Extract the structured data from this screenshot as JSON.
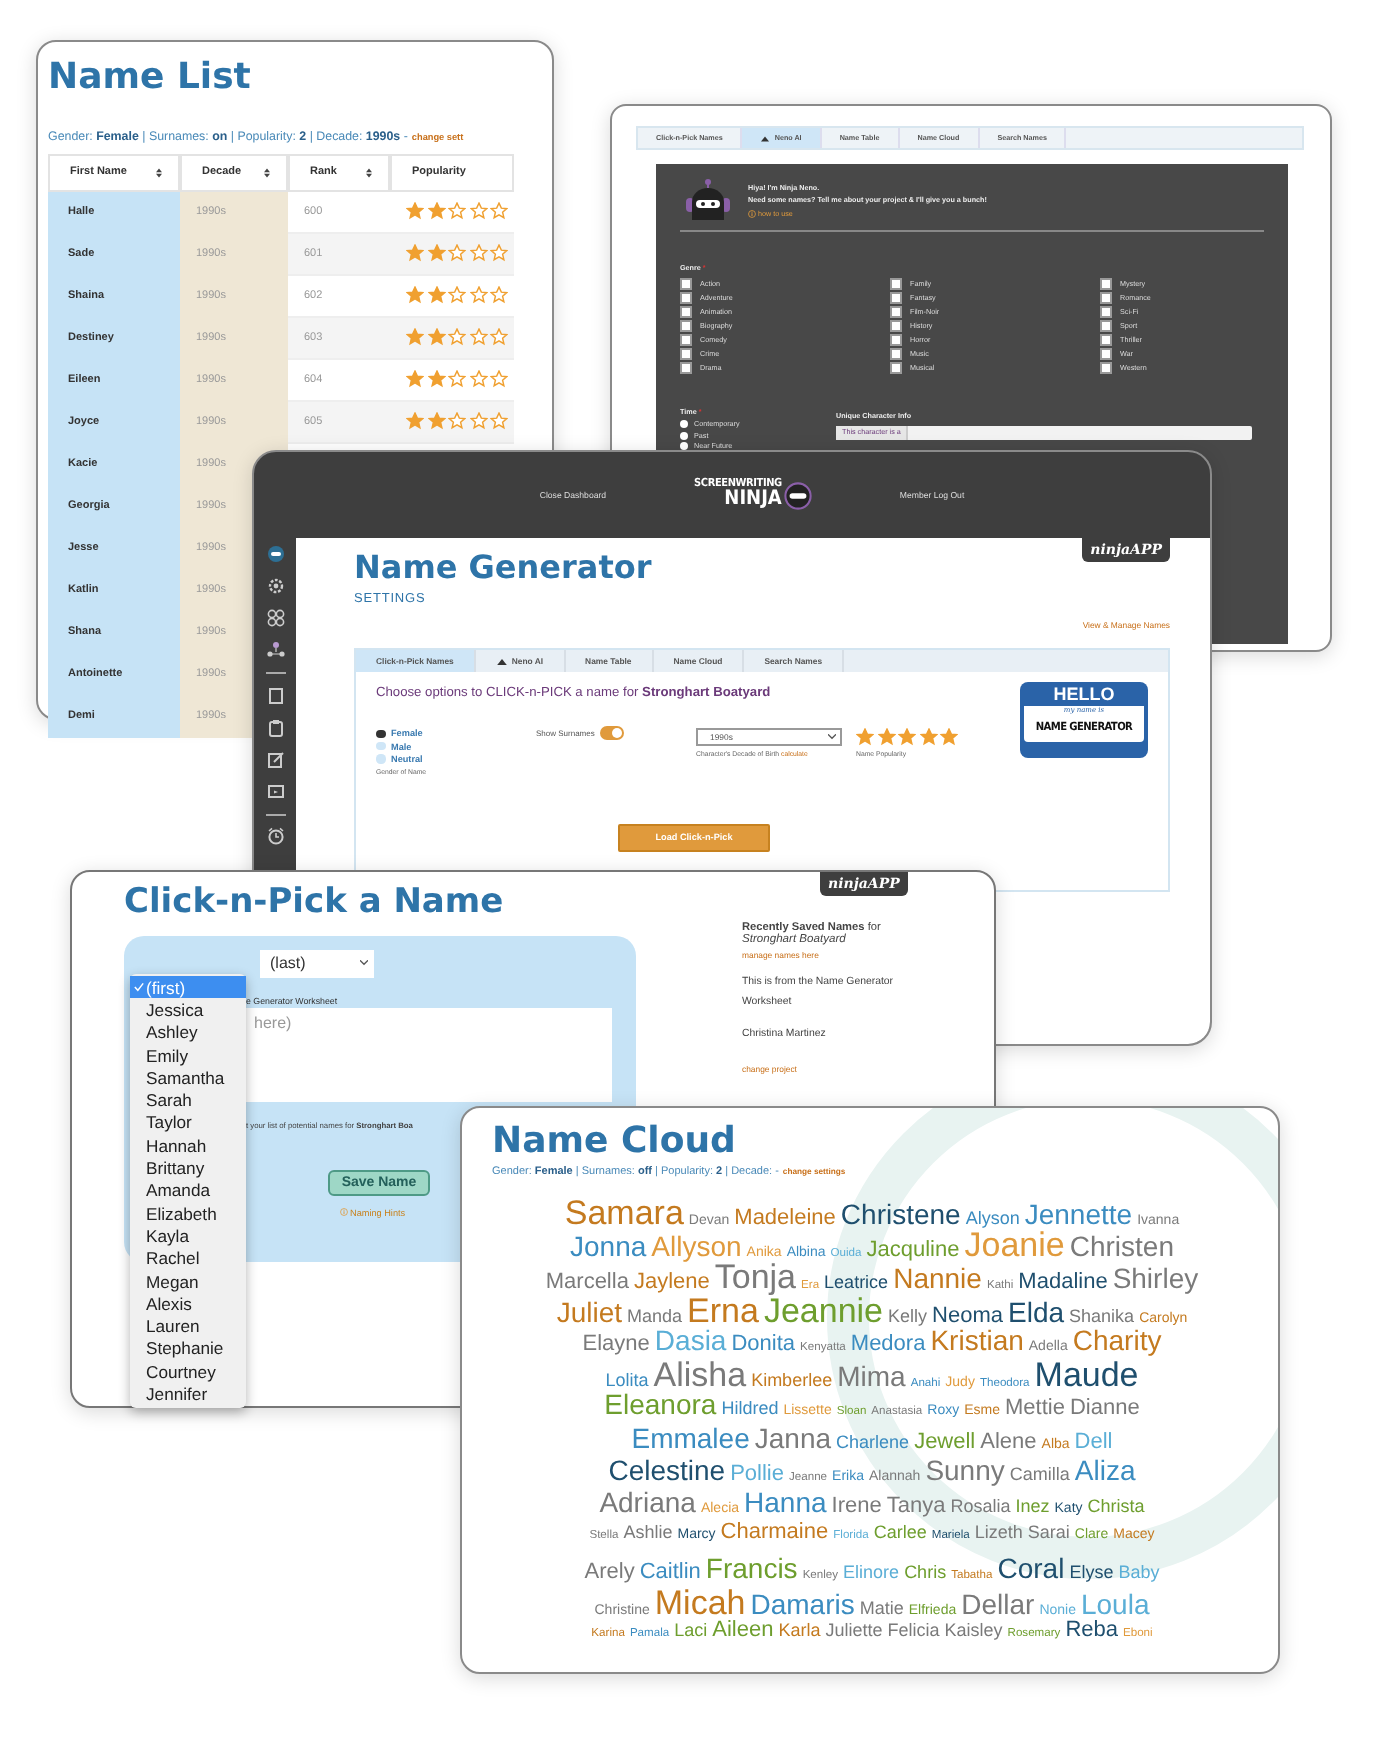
{
  "name_list": {
    "title": "Name List",
    "filter": "Gender: **Female** | Surnames: **on** | Popularity: **2** | Decade: **1990s** -",
    "change_link": "change sett",
    "columns": [
      "First Name",
      "Decade",
      "Rank",
      "Popularity"
    ],
    "rows": [
      {
        "name": "Halle",
        "decade": "1990s",
        "rank": "600",
        "stars": 2
      },
      {
        "name": "Sade",
        "decade": "1990s",
        "rank": "601",
        "stars": 2
      },
      {
        "name": "Shaina",
        "decade": "1990s",
        "rank": "602",
        "stars": 2
      },
      {
        "name": "Destiney",
        "decade": "1990s",
        "rank": "603",
        "stars": 2
      },
      {
        "name": "Eileen",
        "decade": "1990s",
        "rank": "604",
        "stars": 2
      },
      {
        "name": "Joyce",
        "decade": "1990s",
        "rank": "605",
        "stars": 2
      },
      {
        "name": "Kacie",
        "decade": "1990s"
      },
      {
        "name": "Georgia",
        "decade": "1990s"
      },
      {
        "name": "Jesse",
        "decade": "1990s"
      },
      {
        "name": "Katlin",
        "decade": "1990s"
      },
      {
        "name": "Shana",
        "decade": "1990s"
      },
      {
        "name": "Antoinette",
        "decade": "1990s"
      },
      {
        "name": "Demi",
        "decade": "1990s"
      }
    ]
  },
  "neno": {
    "tabs": [
      {
        "label": "Click-n-Pick Names",
        "selected": false,
        "kind": "text"
      },
      {
        "label": "Neno AI",
        "selected": true,
        "kind": "icon"
      },
      {
        "label": "Name Table",
        "selected": false,
        "kind": "text"
      },
      {
        "label": "Name Cloud",
        "selected": false,
        "kind": "text"
      },
      {
        "label": "Search Names",
        "selected": false,
        "kind": "text"
      }
    ],
    "greeting": "Hiya! I'm Ninja Neno.",
    "intro": "Need some names? Tell me about your project & I'll give you a bunch!",
    "help_link": "how to use",
    "genre_label": "Genre",
    "required_mark": "*",
    "genres": [
      {
        "label": "Action",
        "checked": false
      },
      {
        "label": "Adventure",
        "checked": false
      },
      {
        "label": "Animation",
        "checked": false
      },
      {
        "label": "Biography",
        "checked": false
      },
      {
        "label": "Comedy",
        "checked": false
      },
      {
        "label": "Crime",
        "checked": false
      },
      {
        "label": "Drama",
        "checked": false
      },
      {
        "label": "Family",
        "checked": false
      },
      {
        "label": "Fantasy",
        "checked": false
      },
      {
        "label": "Film-Noir",
        "checked": false
      },
      {
        "label": "History",
        "checked": false
      },
      {
        "label": "Horror",
        "checked": false
      },
      {
        "label": "Music",
        "checked": false
      },
      {
        "label": "Musical",
        "checked": false
      },
      {
        "label": "Mystery",
        "checked": false
      },
      {
        "label": "Romance",
        "checked": false
      },
      {
        "label": "Sci-Fi",
        "checked": false
      },
      {
        "label": "Sport",
        "checked": false
      },
      {
        "label": "Thriller",
        "checked": false
      },
      {
        "label": "War",
        "checked": false
      },
      {
        "label": "Western",
        "checked": false
      }
    ],
    "time_label": "Time",
    "time_required_mark": "*",
    "times": [
      {
        "label": "Contemporary",
        "selected": false
      },
      {
        "label": "Past",
        "selected": false
      },
      {
        "label": "Near Future",
        "selected": false
      }
    ],
    "info_label": "Unique Character Info",
    "info_value": "This character is a"
  },
  "generator": {
    "nav": [
      "Close Dashboard",
      "Member Log Out"
    ],
    "logo_top": "SCREENWRITING",
    "logo_bottom": "NINJA",
    "badge": "ninjaAPP",
    "title": "Name Generator",
    "subtitle": "SETTINGS",
    "manage_link": "View & Manage Names",
    "tabs": [
      {
        "label": "Click-n-Pick Names",
        "selected": true,
        "kind": "text"
      },
      {
        "label": "Neno AI",
        "selected": false,
        "kind": "icon"
      },
      {
        "label": "Name Table",
        "selected": false,
        "kind": "text"
      },
      {
        "label": "Name Cloud",
        "selected": false,
        "kind": "text"
      },
      {
        "label": "Search Names",
        "selected": false,
        "kind": "text"
      }
    ],
    "prompt": "Choose options to CLICK-n-PICK a name for **Stronghart Boatyard**",
    "genders": [
      {
        "label": "Female",
        "selected": true
      },
      {
        "label": "Male",
        "selected": false
      },
      {
        "label": "Neutral",
        "selected": false
      }
    ],
    "gender_caption": "Gender of Name",
    "surnames": {
      "label": "Show Surnames",
      "on": true
    },
    "decade": {
      "value": "1990s",
      "caption": "Character's Decade of Birth",
      "link": "calculate"
    },
    "popularity": {
      "stars": 5,
      "caption": "Name Popularity"
    },
    "name_tag": {
      "title": "HELLO",
      "line": "my name is",
      "name": "NAME GENERATOR"
    },
    "button": "Load Click-n-Pick"
  },
  "click_pick": {
    "title": "Click-n-Pick a Name",
    "badge": "ninjaAPP",
    "first_menu": [
      {
        "label": "(first)",
        "selected": true
      },
      {
        "label": "Jessica",
        "selected": false
      },
      {
        "label": "Ashley",
        "selected": false
      },
      {
        "label": "Emily",
        "selected": false
      },
      {
        "label": "Samantha",
        "selected": false
      },
      {
        "label": "Sarah",
        "selected": false
      },
      {
        "label": "Taylor",
        "selected": false
      },
      {
        "label": "Hannah",
        "selected": false
      },
      {
        "label": "Brittany",
        "selected": false
      },
      {
        "label": "Amanda",
        "selected": false
      },
      {
        "label": "Elizabeth",
        "selected": false
      },
      {
        "label": "Kayla",
        "selected": false
      },
      {
        "label": "Rachel",
        "selected": false
      },
      {
        "label": "Megan",
        "selected": false
      },
      {
        "label": "Alexis",
        "selected": false
      },
      {
        "label": "Lauren",
        "selected": false
      },
      {
        "label": "Stephanie",
        "selected": false
      },
      {
        "label": "Courtney",
        "selected": false
      },
      {
        "label": "Jennifer",
        "selected": false
      }
    ],
    "last_select": "(last)",
    "worksheet_label": "e Generator Worksheet",
    "notes_placeholder": "here)",
    "hint": "t your list of potential names for **Stronghart Boa**",
    "save_button": "Save Name",
    "hints_link": "Naming Hints",
    "recent": {
      "heading": "**Recently Saved Names** for",
      "project": "Stronghart Boatyard",
      "manage": "manage names here",
      "items": [
        "This is from the Name Generator Worksheet",
        "Christina Martinez"
      ],
      "change": "change project"
    }
  },
  "name_cloud": {
    "title": "Name Cloud",
    "filter": "Gender: **Female** | Surnames: **off** | Popularity: **2** | Decade: -",
    "change_link": "change settings",
    "lines": [
      {
        "words": [
          {
            "text": "Samara",
            "kind": "xl",
            "color": "#c47a1f"
          },
          {
            "text": "Devan",
            "kind": "xs",
            "color": "#7a7a7a"
          },
          {
            "text": "Madeleine",
            "kind": "m",
            "color": "#c47a1f"
          },
          {
            "text": "Christene",
            "kind": "l",
            "color": "#1f4f6e"
          },
          {
            "text": "Alyson",
            "kind": "s",
            "color": "#3b8cc0"
          },
          {
            "text": "Jennette",
            "kind": "l",
            "color": "#3b8cc0"
          },
          {
            "text": "Ivanna",
            "kind": "xs",
            "color": "#7a7a7a"
          }
        ]
      },
      {
        "words": [
          {
            "text": "Jonna",
            "kind": "l",
            "color": "#3b8cc0"
          },
          {
            "text": "Allyson",
            "kind": "l",
            "color": "#e09a3c"
          },
          {
            "text": "Anika",
            "kind": "xs",
            "color": "#e09a3c"
          },
          {
            "text": "Albina",
            "kind": "xs",
            "color": "#3b8cc0"
          },
          {
            "text": "Ouida",
            "kind": "xxs",
            "color": "#5aaed6"
          },
          {
            "text": "Jacquline",
            "kind": "m",
            "color": "#6e9e2e"
          },
          {
            "text": "Joanie",
            "kind": "xl",
            "color": "#e09a3c"
          },
          {
            "text": "Christen",
            "kind": "l",
            "color": "#7a7a7a"
          }
        ]
      },
      {
        "words": [
          {
            "text": "Marcella",
            "kind": "m",
            "color": "#7a7a7a"
          },
          {
            "text": "Jaylene",
            "kind": "m",
            "color": "#c47a1f"
          },
          {
            "text": "Tonja",
            "kind": "xl",
            "color": "#7a7a7a"
          },
          {
            "text": "Era",
            "kind": "xxs",
            "color": "#e09a3c"
          },
          {
            "text": "Leatrice",
            "kind": "s",
            "color": "#1f4f6e"
          },
          {
            "text": "Nannie",
            "kind": "l",
            "color": "#c47a1f"
          },
          {
            "text": "Kathi",
            "kind": "xxs",
            "color": "#7a7a7a"
          },
          {
            "text": "Madaline",
            "kind": "m",
            "color": "#1f4f6e"
          },
          {
            "text": "Shirley",
            "kind": "l",
            "color": "#7a7a7a"
          }
        ]
      },
      {
        "words": [
          {
            "text": "Juliet",
            "kind": "l",
            "color": "#c47a1f"
          },
          {
            "text": "Manda",
            "kind": "s",
            "color": "#7a7a7a"
          },
          {
            "text": "Erna",
            "kind": "xl",
            "color": "#c47a1f"
          },
          {
            "text": "Jeannie",
            "kind": "xl",
            "color": "#6e9e2e"
          },
          {
            "text": "Kelly",
            "kind": "s",
            "color": "#7a7a7a"
          },
          {
            "text": "Neoma",
            "kind": "m",
            "color": "#1f4f6e"
          },
          {
            "text": "Elda",
            "kind": "l",
            "color": "#1f4f6e"
          },
          {
            "text": "Shanika",
            "kind": "s",
            "color": "#7a7a7a"
          },
          {
            "text": "Carolyn",
            "kind": "xs",
            "color": "#c47a1f"
          }
        ]
      },
      {
        "words": [
          {
            "text": "Elayne",
            "kind": "m",
            "color": "#7a7a7a"
          },
          {
            "text": "Dasia",
            "kind": "l",
            "color": "#5aaed6"
          },
          {
            "text": "Donita",
            "kind": "m",
            "color": "#3b8cc0"
          },
          {
            "text": "Kenyatta",
            "kind": "xxs",
            "color": "#7a7a7a"
          },
          {
            "text": "Medora",
            "kind": "m",
            "color": "#3b8cc0"
          },
          {
            "text": "Kristian",
            "kind": "l",
            "color": "#c47a1f"
          },
          {
            "text": "Adella",
            "kind": "xs",
            "color": "#7a7a7a"
          },
          {
            "text": "Charity",
            "kind": "l",
            "color": "#c47a1f"
          }
        ]
      },
      {
        "words": [
          {
            "text": "Lolita",
            "kind": "s",
            "color": "#3b8cc0"
          },
          {
            "text": "Alisha",
            "kind": "xl",
            "color": "#7a7a7a"
          },
          {
            "text": "Kimberlee",
            "kind": "s",
            "color": "#c47a1f"
          },
          {
            "text": "Mima",
            "kind": "l",
            "color": "#7a7a7a"
          },
          {
            "text": "Anahi",
            "kind": "xxs",
            "color": "#3b8cc0"
          },
          {
            "text": "Judy",
            "kind": "xs",
            "color": "#e09a3c"
          },
          {
            "text": "Theodora",
            "kind": "xxs",
            "color": "#3b8cc0"
          },
          {
            "text": "Maude",
            "kind": "xl",
            "color": "#1f4f6e"
          }
        ]
      },
      {
        "words": [
          {
            "text": "Eleanora",
            "kind": "l",
            "color": "#6e9e2e"
          },
          {
            "text": "Hildred",
            "kind": "s",
            "color": "#3b8cc0"
          },
          {
            "text": "Lissette",
            "kind": "xs",
            "color": "#e09a3c"
          },
          {
            "text": "Sloan",
            "kind": "xxs",
            "color": "#6e9e2e"
          },
          {
            "text": "Anastasia",
            "kind": "xxs",
            "color": "#7a7a7a"
          },
          {
            "text": "Roxy",
            "kind": "xs",
            "color": "#3b8cc0"
          },
          {
            "text": "Esme",
            "kind": "xs",
            "color": "#c47a1f"
          },
          {
            "text": "Mettie",
            "kind": "m",
            "color": "#7a7a7a"
          },
          {
            "text": "Dianne",
            "kind": "m",
            "color": "#7a7a7a"
          }
        ]
      },
      {
        "words": [
          {
            "text": "Emmalee",
            "kind": "l",
            "color": "#3b8cc0"
          },
          {
            "text": "Janna",
            "kind": "l",
            "color": "#7a7a7a"
          },
          {
            "text": "Charlene",
            "kind": "s",
            "color": "#3b8cc0"
          },
          {
            "text": "Jewell",
            "kind": "m",
            "color": "#6e9e2e"
          },
          {
            "text": "Alene",
            "kind": "m",
            "color": "#7a7a7a"
          },
          {
            "text": "Alba",
            "kind": "xs",
            "color": "#c47a1f"
          },
          {
            "text": "Dell",
            "kind": "m",
            "color": "#5aaed6"
          }
        ]
      },
      {
        "words": [
          {
            "text": "Celestine",
            "kind": "l",
            "color": "#1f4f6e"
          },
          {
            "text": "Pollie",
            "kind": "m",
            "color": "#5aaed6"
          },
          {
            "text": "Jeanne",
            "kind": "xxs",
            "color": "#7a7a7a"
          },
          {
            "text": "Erika",
            "kind": "xs",
            "color": "#3b8cc0"
          },
          {
            "text": "Alannah",
            "kind": "xs",
            "color": "#7a7a7a"
          },
          {
            "text": "Sunny",
            "kind": "l",
            "color": "#7a7a7a"
          },
          {
            "text": "Camilla",
            "kind": "s",
            "color": "#7a7a7a"
          },
          {
            "text": "Aliza",
            "kind": "l",
            "color": "#3b8cc0"
          }
        ]
      },
      {
        "words": [
          {
            "text": "Adriana",
            "kind": "l",
            "color": "#7a7a7a"
          },
          {
            "text": "Alecia",
            "kind": "xs",
            "color": "#e09a3c"
          },
          {
            "text": "Hanna",
            "kind": "l",
            "color": "#3b8cc0"
          },
          {
            "text": "Irene",
            "kind": "m",
            "color": "#7a7a7a"
          },
          {
            "text": "Tanya",
            "kind": "m",
            "color": "#7a7a7a"
          },
          {
            "text": "Rosalia",
            "kind": "s",
            "color": "#7a7a7a"
          },
          {
            "text": "Inez",
            "kind": "s",
            "color": "#6e9e2e"
          },
          {
            "text": "Katy",
            "kind": "xs",
            "color": "#1f4f6e"
          },
          {
            "text": "Christa",
            "kind": "s",
            "color": "#6e9e2e"
          }
        ]
      },
      {
        "words": [
          {
            "text": "Stella",
            "kind": "xxs",
            "color": "#7a7a7a"
          },
          {
            "text": "Ashlie",
            "kind": "s",
            "color": "#7a7a7a"
          },
          {
            "text": "Marcy",
            "kind": "xs",
            "color": "#1f4f6e"
          },
          {
            "text": "Charmaine",
            "kind": "m",
            "color": "#c47a1f"
          },
          {
            "text": "Florida",
            "kind": "xxs",
            "color": "#5aaed6"
          },
          {
            "text": "Carlee",
            "kind": "s",
            "color": "#6e9e2e"
          },
          {
            "text": "Mariela",
            "kind": "xxs",
            "color": "#1f4f6e"
          },
          {
            "text": "Lizeth",
            "kind": "s",
            "color": "#7a7a7a"
          },
          {
            "text": "Sarai",
            "kind": "s",
            "color": "#7a7a7a"
          },
          {
            "text": "Clare",
            "kind": "xs",
            "color": "#6e9e2e"
          },
          {
            "text": "Macey",
            "kind": "xs",
            "color": "#c47a1f"
          }
        ]
      },
      {
        "words": [
          {
            "text": "Arely",
            "kind": "m",
            "color": "#7a7a7a"
          },
          {
            "text": "Caitlin",
            "kind": "m",
            "color": "#3b8cc0"
          },
          {
            "text": "Francis",
            "kind": "l",
            "color": "#6e9e2e"
          },
          {
            "text": "Kenley",
            "kind": "xxs",
            "color": "#7a7a7a"
          },
          {
            "text": "Elinore",
            "kind": "s",
            "color": "#5aaed6"
          },
          {
            "text": "Chris",
            "kind": "s",
            "color": "#6e9e2e"
          },
          {
            "text": "Tabatha",
            "kind": "xxs",
            "color": "#c47a1f"
          },
          {
            "text": "Coral",
            "kind": "l",
            "color": "#1f4f6e"
          },
          {
            "text": "Elyse",
            "kind": "s",
            "color": "#1f4f6e"
          },
          {
            "text": "Baby",
            "kind": "s",
            "color": "#5aaed6"
          }
        ]
      },
      {
        "words": [
          {
            "text": "Christine",
            "kind": "xs",
            "color": "#7a7a7a"
          },
          {
            "text": "Micah",
            "kind": "xl",
            "color": "#c47a1f"
          },
          {
            "text": "Damaris",
            "kind": "l",
            "color": "#3b8cc0"
          },
          {
            "text": "Matie",
            "kind": "s",
            "color": "#7a7a7a"
          },
          {
            "text": "Elfrieda",
            "kind": "xs",
            "color": "#6e9e2e"
          },
          {
            "text": "Dellar",
            "kind": "l",
            "color": "#7a7a7a"
          },
          {
            "text": "Nonie",
            "kind": "xs",
            "color": "#5aaed6"
          },
          {
            "text": "Loula",
            "kind": "l",
            "color": "#5aaed6"
          }
        ]
      },
      {
        "words": [
          {
            "text": "Karina",
            "kind": "xxs",
            "color": "#c47a1f"
          },
          {
            "text": "Pamala",
            "kind": "xxs",
            "color": "#3b8cc0"
          },
          {
            "text": "Laci",
            "kind": "s",
            "color": "#6e9e2e"
          },
          {
            "text": "Aileen",
            "kind": "m",
            "color": "#6e9e2e"
          },
          {
            "text": "Karla",
            "kind": "s",
            "color": "#c47a1f"
          },
          {
            "text": "Juliette",
            "kind": "s",
            "color": "#7a7a7a"
          },
          {
            "text": "Felicia",
            "kind": "s",
            "color": "#7a7a7a"
          },
          {
            "text": "Kaisley",
            "kind": "s",
            "color": "#7a7a7a"
          },
          {
            "text": "Rosemary",
            "kind": "xxs",
            "color": "#6e9e2e"
          },
          {
            "text": "Reba",
            "kind": "m",
            "color": "#1f4f6e"
          },
          {
            "text": "Eboni",
            "kind": "xxs",
            "color": "#e09a3c"
          }
        ]
      }
    ]
  }
}
